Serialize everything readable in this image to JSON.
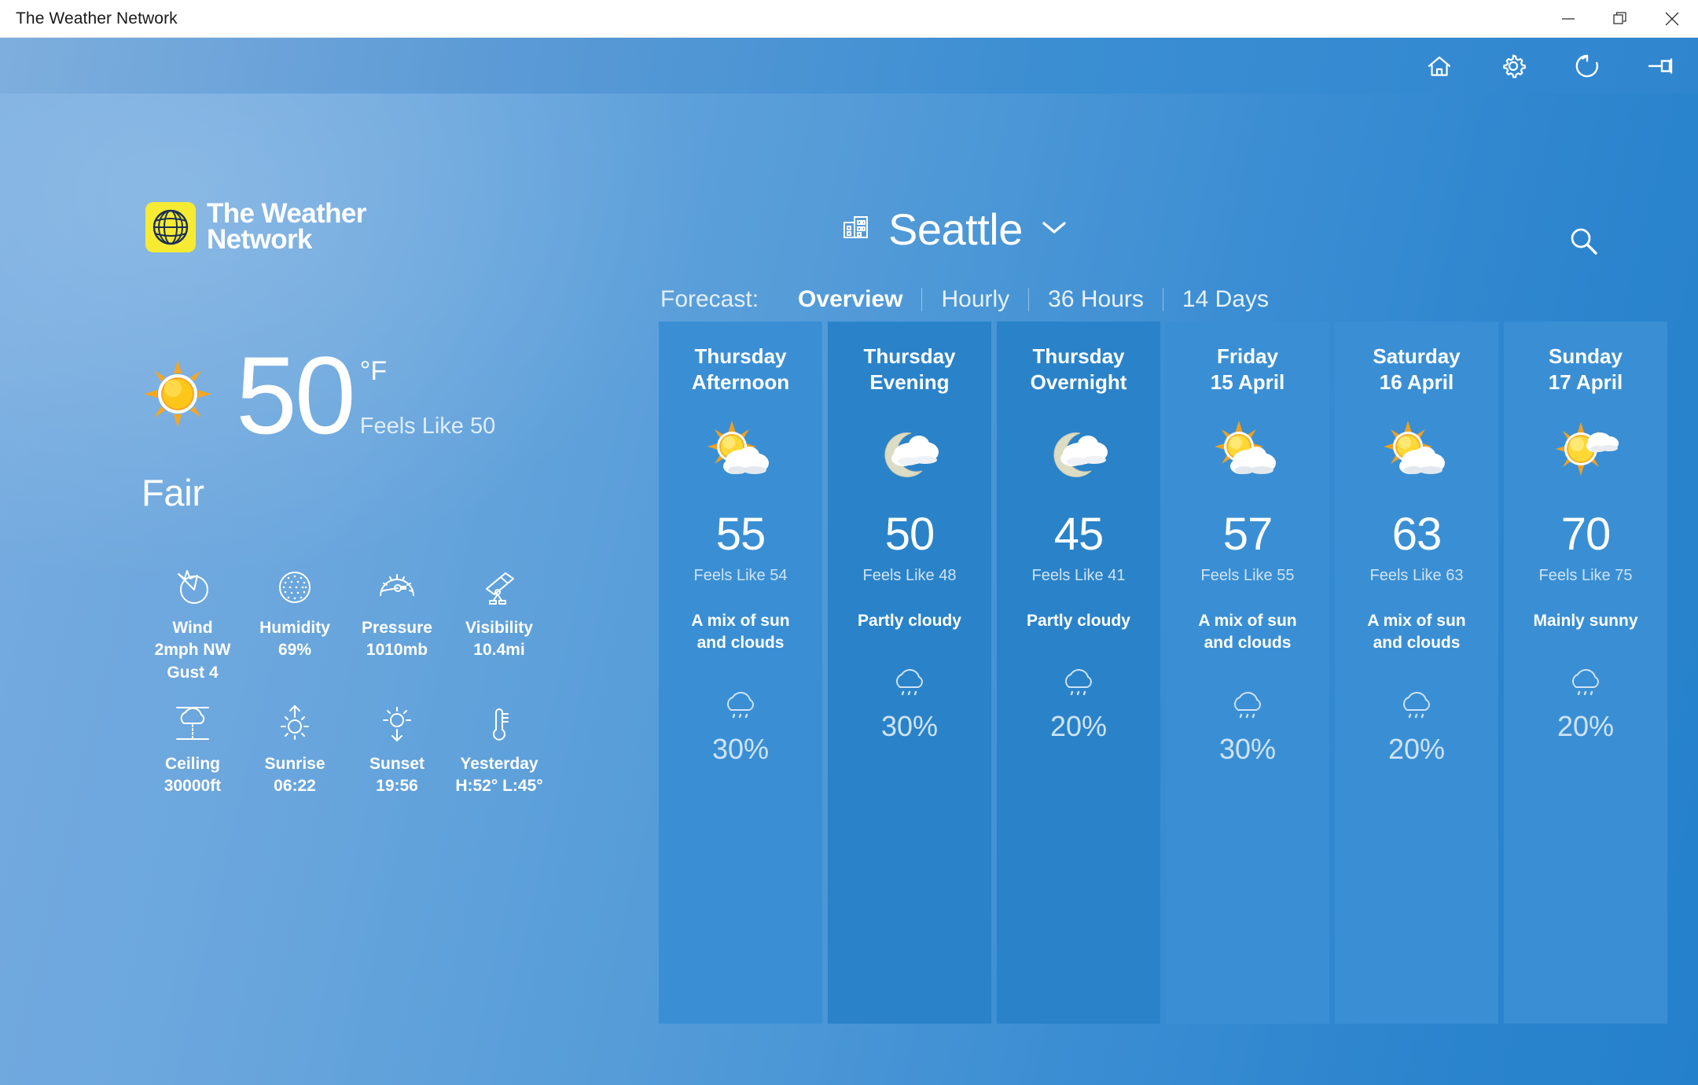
{
  "window": {
    "title": "The Weather Network",
    "controls": [
      {
        "name": "minimize",
        "glyph": "minimize"
      },
      {
        "name": "restore",
        "glyph": "restore"
      },
      {
        "name": "close",
        "glyph": "close"
      }
    ]
  },
  "toolbar": {
    "buttons": [
      {
        "name": "home-icon",
        "label": "Home"
      },
      {
        "name": "gear-icon",
        "label": "Settings"
      },
      {
        "name": "refresh-icon",
        "label": "Refresh"
      },
      {
        "name": "pin-icon",
        "label": "Pin"
      }
    ]
  },
  "brand": {
    "line1": "The Weather",
    "line2": "Network",
    "mark_color": "#f6eb32",
    "mark_ink": "#1b2f52"
  },
  "header": {
    "city": "Seattle",
    "city_icon": "buildings-icon",
    "dropdown_icon": "chevron-down-icon",
    "search_icon": "search-icon"
  },
  "forecast_nav": {
    "label": "Forecast:",
    "tabs": [
      {
        "label": "Overview",
        "active": true
      },
      {
        "label": "Hourly",
        "active": false
      },
      {
        "label": "36 Hours",
        "active": false
      },
      {
        "label": "14 Days",
        "active": false
      }
    ]
  },
  "current": {
    "icon": "sunny-icon",
    "temperature": "50",
    "unit": "°F",
    "feels_like": "Feels Like 50",
    "condition": "Fair"
  },
  "details": [
    {
      "icon": "wind-icon",
      "label": "Wind",
      "value": "2mph NW",
      "extra": "Gust 4"
    },
    {
      "icon": "humidity-icon",
      "label": "Humidity",
      "value": "69%",
      "extra": ""
    },
    {
      "icon": "pressure-icon",
      "label": "Pressure",
      "value": "1010mb",
      "extra": ""
    },
    {
      "icon": "visibility-icon",
      "label": "Visibility",
      "value": "10.4mi",
      "extra": ""
    },
    {
      "icon": "ceiling-icon",
      "label": "Ceiling",
      "value": "30000ft",
      "extra": ""
    },
    {
      "icon": "sunrise-icon",
      "label": "Sunrise",
      "value": "06:22",
      "extra": ""
    },
    {
      "icon": "sunset-icon",
      "label": "Sunset",
      "value": "19:56",
      "extra": ""
    },
    {
      "icon": "thermometer-icon",
      "label": "Yesterday",
      "value": "H:52° L:45°",
      "extra": ""
    }
  ],
  "cards": [
    {
      "day": "Thursday",
      "period": "Afternoon",
      "icon": "sun-behind-cloud-icon",
      "temperature": "55",
      "feels_like": "Feels Like 54",
      "condition": "A mix of sun and clouds",
      "pop": "30%",
      "dark": false
    },
    {
      "day": "Thursday",
      "period": "Evening",
      "icon": "moon-behind-cloud-icon",
      "temperature": "50",
      "feels_like": "Feels Like 48",
      "condition": "Partly cloudy",
      "pop": "30%",
      "dark": true
    },
    {
      "day": "Thursday",
      "period": "Overnight",
      "icon": "moon-behind-cloud-icon",
      "temperature": "45",
      "feels_like": "Feels Like 41",
      "condition": "Partly cloudy",
      "pop": "20%",
      "dark": true
    },
    {
      "day": "Friday",
      "period": "15 April",
      "icon": "sun-behind-cloud-icon",
      "temperature": "57",
      "feels_like": "Feels Like 55",
      "condition": "A mix of sun and clouds",
      "pop": "30%",
      "dark": false
    },
    {
      "day": "Saturday",
      "period": "16 April",
      "icon": "sun-behind-cloud-icon",
      "temperature": "63",
      "feels_like": "Feels Like 63",
      "condition": "A mix of sun and clouds",
      "pop": "20%",
      "dark": false
    },
    {
      "day": "Sunday",
      "period": "17 April",
      "icon": "sun-small-cloud-icon",
      "temperature": "70",
      "feels_like": "Feels Like 75",
      "condition": "Mainly sunny",
      "pop": "20%",
      "dark": false
    }
  ],
  "colors": {
    "background_left": "#77ace0",
    "background_right": "#2580cb",
    "card": "#3a8fd4",
    "card_dark": "#2a83c9",
    "accent_yellow": "#f6eb32",
    "text": "#ffffff",
    "muted_text": "#cfe3f5"
  }
}
